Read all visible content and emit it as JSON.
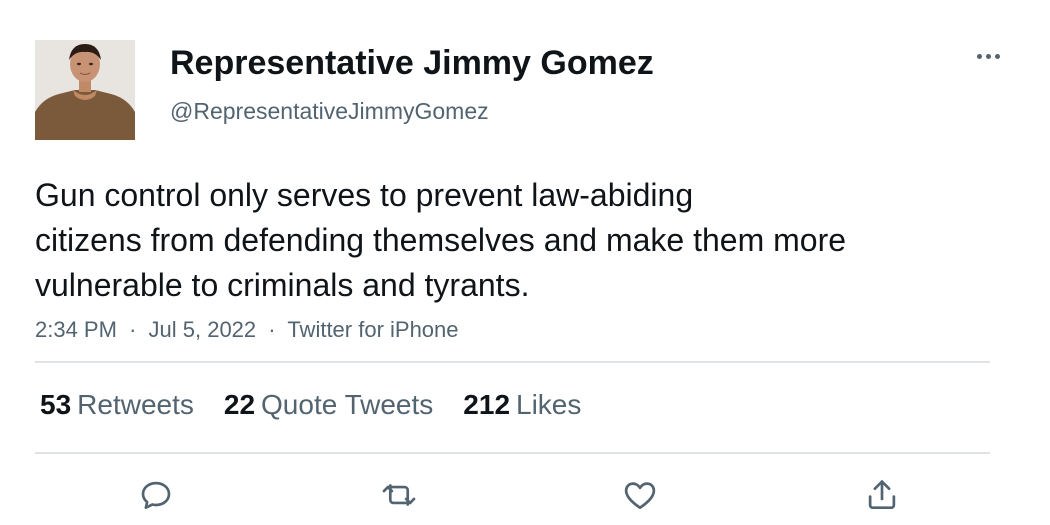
{
  "tweet": {
    "author": {
      "display_name": "Representative Jimmy Gomez",
      "handle": "@RepresentativeJimmyGomez"
    },
    "text_lines": [
      "Gun control only serves to prevent law-abiding",
      "citizens from defending themselves and make them more",
      "vulnerable to criminals and tyrants."
    ],
    "meta": {
      "time": "2:34 PM",
      "separator": "·",
      "date": "Jul 5, 2022",
      "source": "Twitter for iPhone"
    },
    "stats": [
      {
        "count": "53",
        "label": "Retweets"
      },
      {
        "count": "22",
        "label": "Quote Tweets"
      },
      {
        "count": "212",
        "label": "Likes"
      }
    ],
    "actions": [
      "reply-icon",
      "retweet-icon",
      "like-icon",
      "share-icon"
    ],
    "more_icon": "more-options-icon"
  },
  "colors": {
    "text_primary": "#0f1419",
    "text_secondary": "#536471",
    "divider": "#dfe3e6",
    "background": "#ffffff"
  }
}
